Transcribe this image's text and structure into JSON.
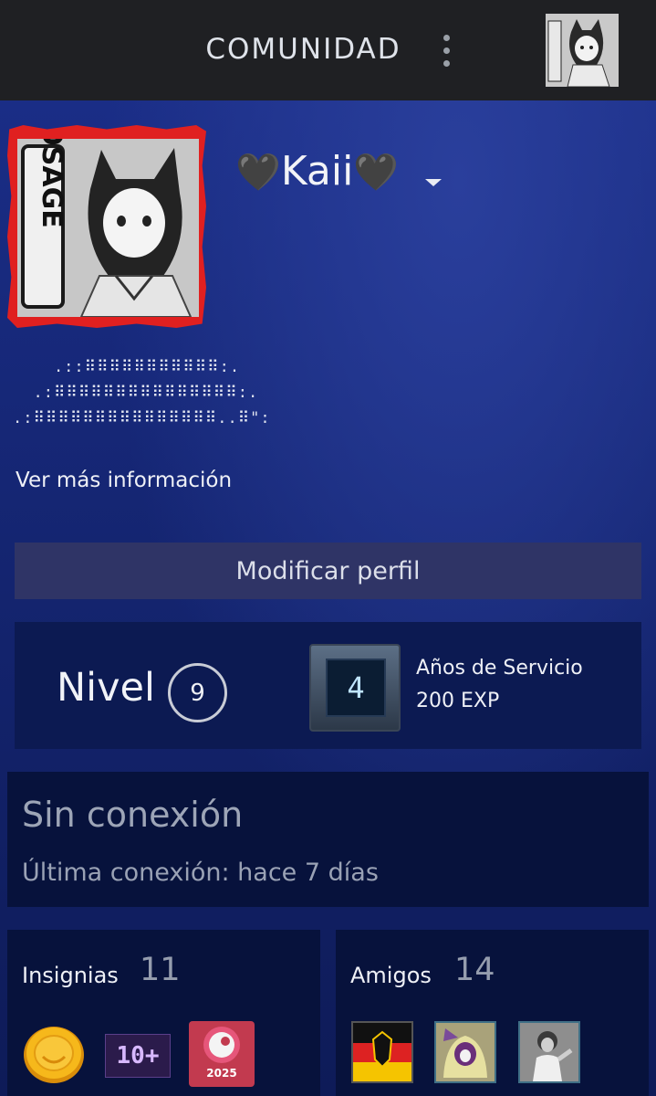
{
  "header": {
    "title": "COMUNIDAD",
    "menu_icon": "kebab-icon"
  },
  "profile": {
    "username": "Kaii",
    "heart_glyph": "🖤",
    "summary_art": [
      "    .::⠿⠿⠿⠿⠿⠿⠿⠿⠿⠿⠿:.",
      "  .:⠿⠿⠿⠿⠿⠿⠿⠿⠿⠿⠿⠿⠿⠿⠿:.",
      ".:⠿⠿⠿⠿⠿⠿⠿⠿⠿⠿⠿⠿⠿⠿⠿..⠿\":"
    ],
    "more_info": "Ver más información",
    "avatar_frame_color": "#e02020"
  },
  "actions": {
    "edit_profile": "Modificar perfil"
  },
  "level": {
    "label": "Nivel",
    "value": "9",
    "badge_value": "4",
    "badge_title": "Años de Servicio",
    "badge_xp": "200 EXP"
  },
  "status": {
    "state": "Sin conexión",
    "last_seen": "Última conexión: hace 7 días"
  },
  "badges": {
    "title": "Insignias",
    "count": "11",
    "items": [
      {
        "name": "gold-coin-badge"
      },
      {
        "name": "10-plus-badge",
        "text": "10+"
      },
      {
        "name": "steam-2025-badge",
        "text": "2025"
      }
    ]
  },
  "friends": {
    "title": "Amigos",
    "count": "14",
    "items": [
      {
        "name": "friend-avatar-flag"
      },
      {
        "name": "friend-avatar-character"
      },
      {
        "name": "friend-avatar-photo"
      }
    ]
  }
}
